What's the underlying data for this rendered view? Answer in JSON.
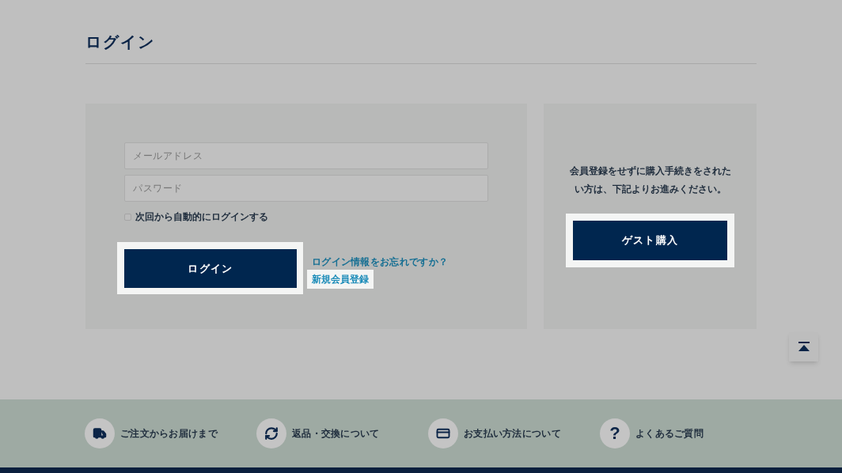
{
  "page_title": "ログイン",
  "login_form": {
    "email": {
      "placeholder": "メールアドレス"
    },
    "password": {
      "placeholder": "パスワード"
    },
    "remember": {
      "label": "次回から自動的にログインする",
      "checked": false
    },
    "submit": "ログイン",
    "forgot_link": "ログイン情報をお忘れですか？",
    "register_link": "新規会員登録"
  },
  "guest": {
    "description": "会員登録をせずに購入手続きをされたい方は、下記よりお進みください。",
    "button": "ゲスト購入"
  },
  "footer_links": [
    {
      "kind": "truck",
      "label": "ご注文からお届けまで"
    },
    {
      "kind": "refresh",
      "label": "返品・交換について"
    },
    {
      "kind": "card",
      "label": "お支払い方法について"
    },
    {
      "kind": "question",
      "label": "よくあるご質問",
      "glyph": "?"
    }
  ]
}
